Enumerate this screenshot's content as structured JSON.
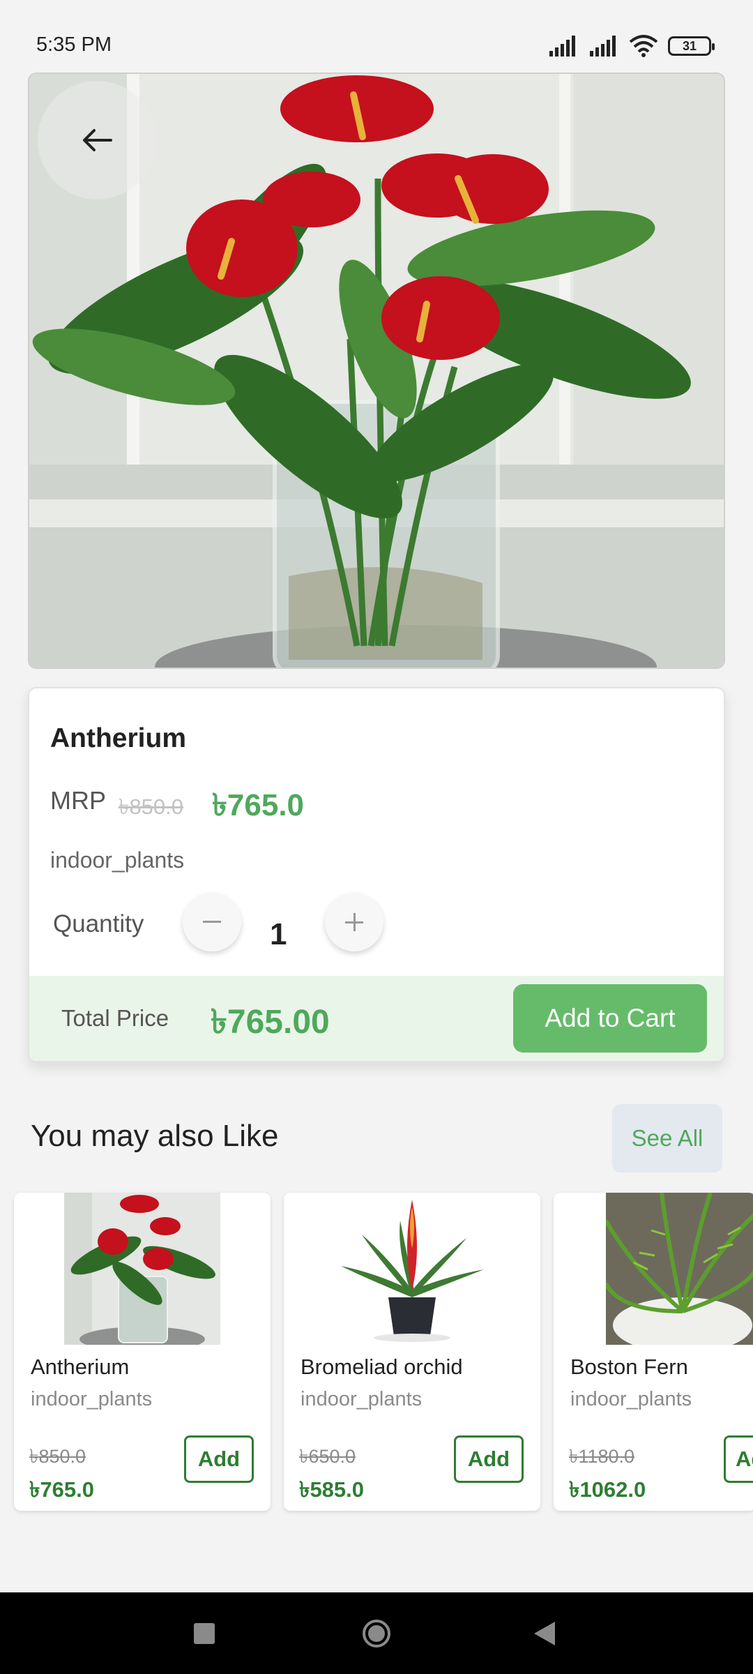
{
  "status_bar": {
    "time": "5:35 PM",
    "battery": "31",
    "icons": [
      "signal-icon",
      "signal-icon",
      "wifi-icon",
      "battery-icon"
    ]
  },
  "product": {
    "name": "Antherium",
    "mrp_label": "MRP",
    "mrp_old": "৳850.0",
    "mrp_new": "৳765.0",
    "category": "indoor_plants",
    "quantity_label": "Quantity",
    "quantity": "1",
    "total_label": "Total Price",
    "total_value": "৳765.00",
    "add_to_cart": "Add to Cart"
  },
  "recommendations": {
    "title": "You may also Like",
    "see_all": "See All",
    "items": [
      {
        "name": "Antherium",
        "category": "indoor_plants",
        "old_price": "৳850.0",
        "price": "৳765.0",
        "add": "Add"
      },
      {
        "name": "Bromeliad orchid",
        "category": "indoor_plants",
        "old_price": "৳650.0",
        "price": "৳585.0",
        "add": "Add"
      },
      {
        "name": "Boston Fern",
        "category": "indoor_plants",
        "old_price": "৳1180.0",
        "price": "৳1062.0",
        "add": "Add"
      }
    ]
  },
  "colors": {
    "accent": "#4fa85c",
    "button": "#66bb6a",
    "total_bg": "#eaf5ea",
    "price_dark": "#2e7d32"
  }
}
